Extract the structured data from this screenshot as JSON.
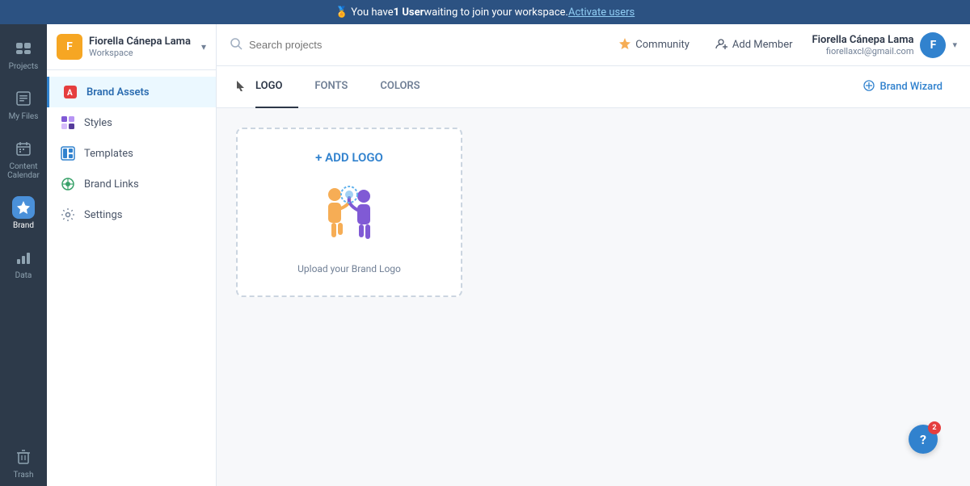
{
  "notification": {
    "text_before": "🏅 You have ",
    "highlight": "1 User",
    "text_after": " waiting to join your workspace. ",
    "link": "Activate users"
  },
  "workspace": {
    "name": "Fiorella Cánepa Lama",
    "sub": "Workspace",
    "avatar_letter": "F"
  },
  "sidebar_nav": {
    "items": [
      {
        "id": "brand-assets",
        "label": "Brand Assets",
        "icon": "🅱",
        "active": true
      },
      {
        "id": "styles",
        "label": "Styles",
        "icon": "◼"
      },
      {
        "id": "templates",
        "label": "Templates",
        "icon": "▦"
      },
      {
        "id": "brand-links",
        "label": "Brand Links",
        "icon": "⊕"
      },
      {
        "id": "settings",
        "label": "Settings",
        "icon": "⚙"
      }
    ]
  },
  "icon_sidebar": {
    "items": [
      {
        "id": "projects",
        "label": "Projects",
        "icon": "📁"
      },
      {
        "id": "my-files",
        "label": "My Files",
        "icon": "🗂"
      },
      {
        "id": "content-calendar",
        "label": "Content Calendar",
        "icon": "📅"
      },
      {
        "id": "my-brand",
        "label": "Brand",
        "icon": "⭐",
        "active": true
      },
      {
        "id": "data",
        "label": "Data",
        "icon": "📊"
      },
      {
        "id": "trash",
        "label": "Trash",
        "icon": "🗑"
      }
    ]
  },
  "header": {
    "search_placeholder": "Search projects",
    "community_label": "Community",
    "add_member_label": "Add Member"
  },
  "user": {
    "name": "Fiorella Cánepa Lama",
    "email": "fiorellaxcl@gmail.com",
    "avatar_letter": "F"
  },
  "tabs": {
    "items": [
      {
        "id": "logo",
        "label": "LOGO",
        "active": true
      },
      {
        "id": "fonts",
        "label": "FONTS"
      },
      {
        "id": "colors",
        "label": "COLORS"
      }
    ],
    "brand_wizard_label": "Brand Wizard"
  },
  "logo_section": {
    "add_label": "+ ADD LOGO",
    "upload_text": "Upload your Brand Logo"
  },
  "help": {
    "label": "?",
    "badge": "2"
  }
}
